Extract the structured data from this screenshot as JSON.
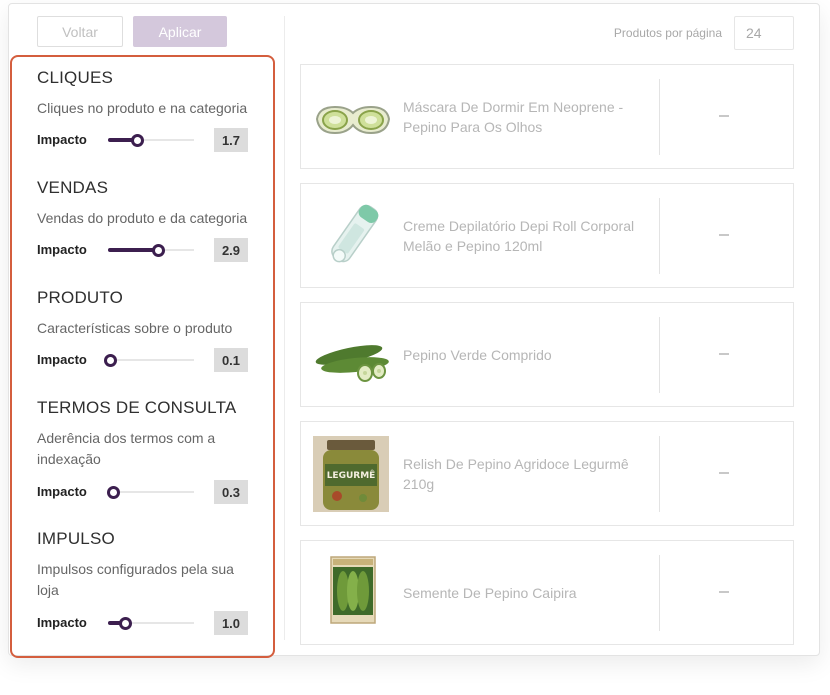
{
  "toolbar": {
    "back_label": "Voltar",
    "apply_label": "Aplicar"
  },
  "pagination": {
    "per_page_label": "Produtos por página",
    "per_page_value": "24"
  },
  "impact_label": "Impacto",
  "factors": [
    {
      "title": "CLIQUES",
      "description": "Cliques no produto e na categoria",
      "value": "1.7",
      "slider_fraction": 0.34
    },
    {
      "title": "VENDAS",
      "description": "Vendas do produto e da categoria",
      "value": "2.9",
      "slider_fraction": 0.58
    },
    {
      "title": "PRODUTO",
      "description": "Características sobre o produto",
      "value": "0.1",
      "slider_fraction": 0.02
    },
    {
      "title": "TERMOS DE CONSULTA",
      "description": "Aderência dos termos com a indexação",
      "value": "0.3",
      "slider_fraction": 0.06
    },
    {
      "title": "IMPULSO",
      "description": "Impulsos configurados pela sua loja",
      "value": "1.0",
      "slider_fraction": 0.2
    }
  ],
  "products": [
    {
      "name": "Máscara De Dormir Em Neoprene - Pepino Para Os Olhos",
      "image": "sleep-mask-image",
      "score": "–"
    },
    {
      "name": "Creme Depilatório Depi Roll Corporal Melão e Pepino 120ml",
      "image": "depilatory-cream-image",
      "score": "–"
    },
    {
      "name": "Pepino Verde Comprido",
      "image": "cucumbers-image",
      "score": "–"
    },
    {
      "name": "Relish De Pepino Agridoce Legurmê 210g",
      "image": "relish-jar-image",
      "score": "–",
      "jar_label": "LEGURMÊ"
    },
    {
      "name": "Semente De Pepino Caipira",
      "image": "seed-packet-image",
      "score": "–"
    }
  ],
  "colors": {
    "accent": "#3c1f4f",
    "highlight_border": "#d45e3e",
    "apply_button": "#d4c8dc"
  }
}
